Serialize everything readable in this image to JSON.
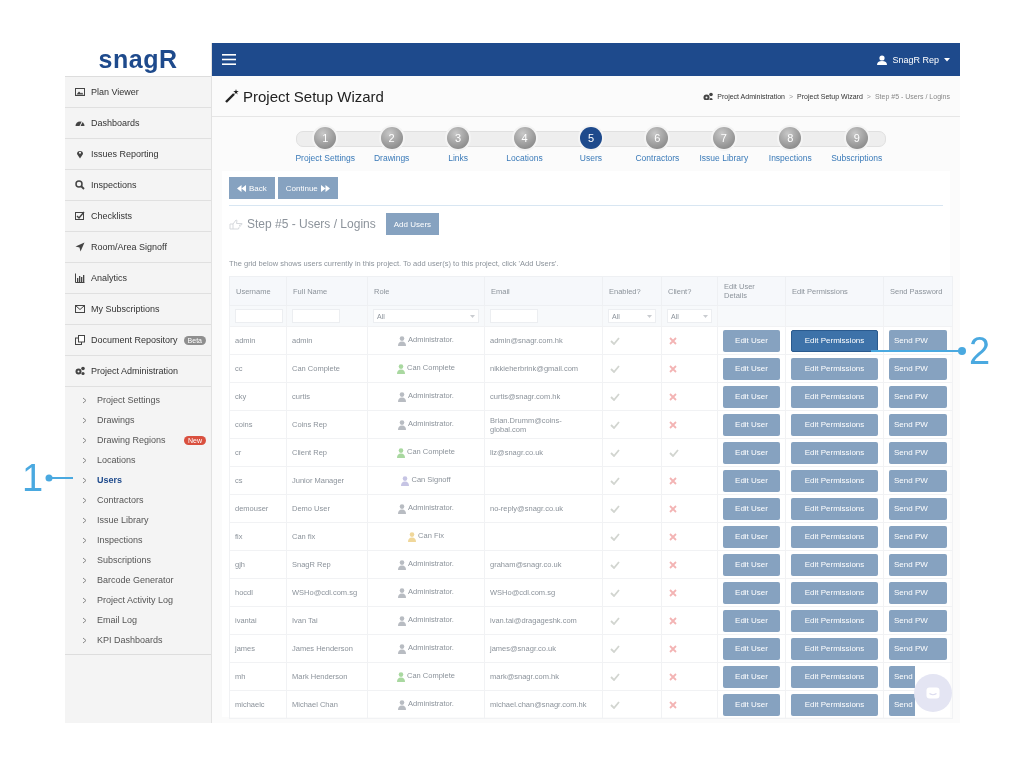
{
  "sidebar": {
    "logo": "snagR",
    "items": [
      {
        "label": "Plan Viewer",
        "kind": "image"
      },
      {
        "label": "Dashboards",
        "kind": "dashboard"
      },
      {
        "label": "Issues Reporting",
        "kind": "pin"
      },
      {
        "label": "Inspections",
        "kind": "search"
      },
      {
        "label": "Checklists",
        "kind": "check"
      },
      {
        "label": "Room/Area Signoff",
        "kind": "send"
      },
      {
        "label": "Analytics",
        "kind": "chart"
      },
      {
        "label": "My Subscriptions",
        "kind": "mail"
      },
      {
        "label": "Document Repository",
        "kind": "docs",
        "badge": "Beta",
        "color": "#8f8f8f"
      },
      {
        "label": "Project Administration",
        "kind": "gears",
        "children": [
          {
            "label": "Project Settings",
            "selected": false
          },
          {
            "label": "Drawings",
            "selected": false
          },
          {
            "label": "Drawing Regions",
            "selected": false,
            "badge": "New",
            "color": "#d9503f"
          },
          {
            "label": "Locations",
            "selected": false
          },
          {
            "label": "Users",
            "selected": true
          },
          {
            "label": "Contractors",
            "selected": false
          },
          {
            "label": "Issue Library",
            "selected": false
          },
          {
            "label": "Inspections",
            "selected": false
          },
          {
            "label": "Subscriptions",
            "selected": false
          },
          {
            "label": "Barcode Generator",
            "selected": false
          },
          {
            "label": "Project Activity Log",
            "selected": false
          },
          {
            "label": "Email Log",
            "selected": false
          },
          {
            "label": "KPI Dashboards",
            "selected": false
          }
        ]
      }
    ]
  },
  "topbar": {
    "user": "SnagR Rep"
  },
  "page_title": "Project Setup Wizard",
  "breadcrumb_separator": ">",
  "breadcrumbs": [
    "Project Administration",
    "Project Setup Wizard",
    "Step #5 - Users / Logins"
  ],
  "steps": [
    {
      "number": "1",
      "label": "Project Settings",
      "selected": false
    },
    {
      "number": "2",
      "label": "Drawings",
      "selected": false
    },
    {
      "number": "3",
      "label": "Links",
      "selected": false
    },
    {
      "number": "4",
      "label": "Locations",
      "selected": false
    },
    {
      "number": "5",
      "label": "Users",
      "selected": true
    },
    {
      "number": "6",
      "label": "Contractors",
      "selected": false
    },
    {
      "number": "7",
      "label": "Issue Library",
      "selected": false
    },
    {
      "number": "8",
      "label": "Inspections",
      "selected": false
    },
    {
      "number": "9",
      "label": "Subscriptions",
      "selected": false
    }
  ],
  "nav_buttons": [
    {
      "label": "Back",
      "kind": "back"
    },
    {
      "label": "Continue",
      "kind": "next"
    }
  ],
  "step_heading": "Step #5 - Users / Logins",
  "add_button": "Add Users",
  "description": "The grid below shows users currently in this project. To add user(s) to this project, click 'Add Users'.",
  "table": {
    "columns": [
      "Username",
      "Full Name",
      "Role",
      "Email",
      "Enabled?",
      "Client?",
      "Edit User Details",
      "Edit Permissions",
      "Send Password"
    ],
    "filters": [
      {
        "kind": "text"
      },
      {
        "kind": "text"
      },
      {
        "kind": "select",
        "placeholder": "All"
      },
      {
        "kind": "text"
      },
      {
        "kind": "select",
        "placeholder": "All"
      },
      {
        "kind": "select",
        "placeholder": "All"
      },
      {
        "kind": "none"
      },
      {
        "kind": "none"
      },
      {
        "kind": "none"
      }
    ],
    "rows": [
      {
        "username": "admin",
        "full_name": "admin",
        "role": "Administrator.",
        "color": "#b8bcc2",
        "email": "admin@snagr.com.hk",
        "enabled": true,
        "client": false,
        "edit_user": "Edit User",
        "edit_permissions": "Edit Permissions",
        "highlighted": true,
        "send": "Send PW"
      },
      {
        "username": "cc",
        "full_name": "Can Complete",
        "role": "Can Complete",
        "color": "#a9d8a0",
        "email": "nikkieherbrink@gmail.com",
        "enabled": true,
        "client": false,
        "edit_user": "Edit User",
        "edit_permissions": "Edit Permissions",
        "highlighted": false,
        "send": "Send PW"
      },
      {
        "username": "cky",
        "full_name": "curtis",
        "role": "Administrator.",
        "color": "#b8bcc2",
        "email": "curtis@snagr.com.hk",
        "enabled": true,
        "client": false,
        "edit_user": "Edit User",
        "edit_permissions": "Edit Permissions",
        "highlighted": false,
        "send": "Send PW"
      },
      {
        "username": "coins",
        "full_name": "Coins Rep",
        "role": "Administrator.",
        "color": "#b8bcc2",
        "email": "Brian.Drumm@coins-global.com",
        "enabled": true,
        "client": false,
        "edit_user": "Edit User",
        "edit_permissions": "Edit Permissions",
        "highlighted": false,
        "send": "Send PW"
      },
      {
        "username": "cr",
        "full_name": "Client Rep",
        "role": "Can Complete",
        "color": "#a9d8a0",
        "email": "liz@snagr.co.uk",
        "enabled": true,
        "client": true,
        "edit_user": "Edit User",
        "edit_permissions": "Edit Permissions",
        "highlighted": false,
        "send": "Send PW"
      },
      {
        "username": "cs",
        "full_name": "Junior Manager",
        "role": "Can Signoff",
        "color": "#c6c4e4",
        "enabled": true,
        "client": false,
        "edit_user": "Edit User",
        "edit_permissions": "Edit Permissions",
        "highlighted": false,
        "send": "Send PW"
      },
      {
        "username": "demouser",
        "full_name": "Demo User",
        "role": "Administrator.",
        "color": "#b8bcc2",
        "email": "no-reply@snagr.co.uk",
        "enabled": true,
        "client": false,
        "edit_user": "Edit User",
        "edit_permissions": "Edit Permissions",
        "highlighted": false,
        "send": "Send PW"
      },
      {
        "username": "fix",
        "full_name": "Can fix",
        "role": "Can Fix",
        "color": "#f0d79a",
        "enabled": true,
        "client": false,
        "edit_user": "Edit User",
        "edit_permissions": "Edit Permissions",
        "highlighted": false,
        "send": "Send PW"
      },
      {
        "username": "gjh",
        "full_name": "SnagR Rep",
        "role": "Administrator.",
        "color": "#b8bcc2",
        "email": "graham@snagr.co.uk",
        "enabled": true,
        "client": false,
        "edit_user": "Edit User",
        "edit_permissions": "Edit Permissions",
        "highlighted": false,
        "send": "Send PW"
      },
      {
        "username": "hocdl",
        "full_name": "WSHo@cdl.com.sg",
        "role": "Administrator.",
        "color": "#b8bcc2",
        "email": "WSHo@cdl.com.sg",
        "enabled": true,
        "client": false,
        "edit_user": "Edit User",
        "edit_permissions": "Edit Permissions",
        "highlighted": false,
        "send": "Send PW"
      },
      {
        "username": "ivantai",
        "full_name": "Ivan Tai",
        "role": "Administrator.",
        "color": "#b8bcc2",
        "email": "ivan.tai@dragageshk.com",
        "enabled": true,
        "client": false,
        "edit_user": "Edit User",
        "edit_permissions": "Edit Permissions",
        "highlighted": false,
        "send": "Send PW"
      },
      {
        "username": "james",
        "full_name": "James Henderson",
        "role": "Administrator.",
        "color": "#b8bcc2",
        "email": "james@snagr.co.uk",
        "enabled": true,
        "client": false,
        "edit_user": "Edit User",
        "edit_permissions": "Edit Permissions",
        "highlighted": false,
        "send": "Send PW"
      },
      {
        "username": "mh",
        "full_name": "Mark Henderson",
        "role": "Can Complete",
        "color": "#a9d8a0",
        "email": "mark@snagr.com.hk",
        "enabled": true,
        "client": false,
        "edit_user": "Edit User",
        "edit_permissions": "Edit Permissions",
        "highlighted": false,
        "send": "Send"
      },
      {
        "username": "michaelc",
        "full_name": "Michael Chan",
        "role": "Administrator.",
        "color": "#b8bcc2",
        "email": "michael.chan@snagr.com.hk",
        "enabled": true,
        "client": false,
        "edit_user": "Edit User",
        "edit_permissions": "Edit Permissions",
        "highlighted": false,
        "send": "Send"
      }
    ]
  },
  "callouts": [
    {
      "label": "1"
    },
    {
      "label": "2"
    }
  ]
}
